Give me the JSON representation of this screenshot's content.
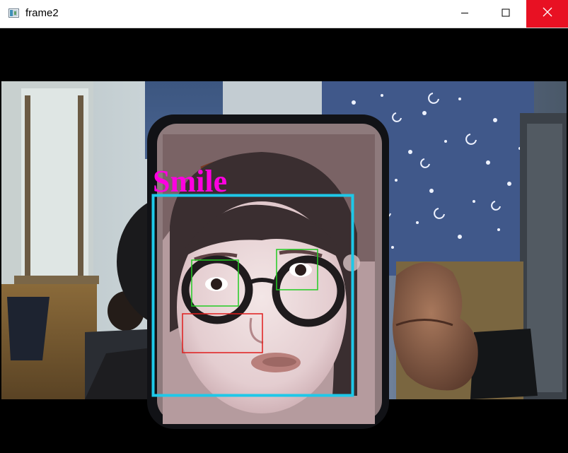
{
  "window": {
    "title": "frame2",
    "controls": {
      "minimize": "minimize",
      "maximize": "maximize",
      "close": "close"
    },
    "colors": {
      "close_hover_bg": "#e81123"
    }
  },
  "video": {
    "detection_label": "Smile",
    "colors": {
      "face_box": "#1ec8e8",
      "eye_box": "#22cc22",
      "mouth_box": "#e01c1c",
      "label": "#ff00e0"
    },
    "icons": {
      "app": "opencv-window-icon",
      "minimize": "minimize-icon",
      "maximize": "maximize-icon",
      "close": "close-icon"
    }
  }
}
